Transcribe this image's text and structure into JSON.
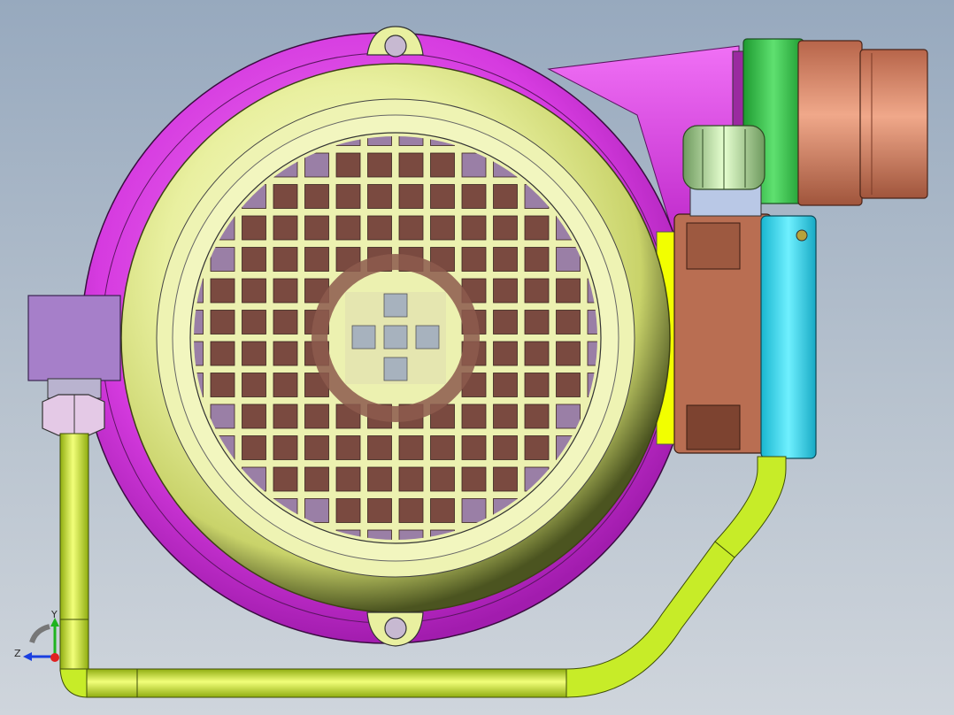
{
  "viewport": {
    "background_top": "#97a9be",
    "background_bottom": "#cfd5dc"
  },
  "triad": {
    "label_y": "Y",
    "label_z": "Z",
    "y_color": "#1fb31f",
    "z_color": "#1a3fe0",
    "x_color": "#e02020"
  },
  "colors": {
    "housing": "#d63be0",
    "motor_cover": "#e9f0a0",
    "grille_cell": "#7a4a40",
    "hub": "#e5e6b0",
    "terminal_box": "#b96e52",
    "terminal_lid": "#2fd7ec",
    "outlet_ring": "#37c54a",
    "outlet_pipe": "#d98c6c",
    "tube": "#c7ec28",
    "fitting_block": "#a67fc9",
    "hex_nut": "#e4c9e6",
    "cable_gland": "#aed49a"
  },
  "icons": [
    "lifting-eye-icon",
    "cable-gland-icon",
    "hex-nut-icon",
    "axis-triad-icon"
  ]
}
